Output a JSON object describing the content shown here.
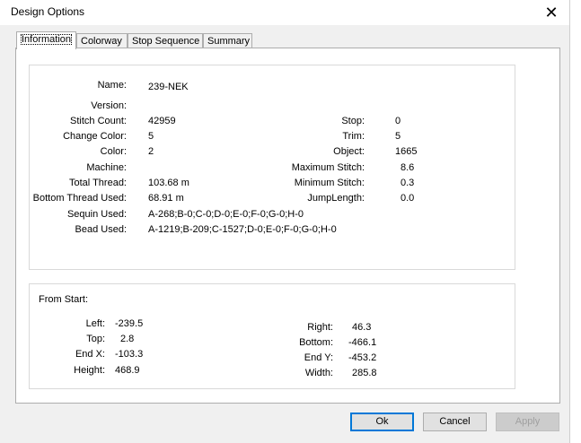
{
  "window": {
    "title": "Design Options",
    "close_glyph": "✕"
  },
  "tabs": [
    {
      "label": "Information"
    },
    {
      "label": "Colorway"
    },
    {
      "label": "Stop Sequence"
    },
    {
      "label": "Summary"
    }
  ],
  "info": {
    "name_label": "Name:",
    "name": "239-NEK",
    "version_label": "Version:",
    "version": "",
    "stitch_count_label": "Stitch Count:",
    "stitch_count": "42959",
    "change_color_label": "Change Color:",
    "change_color": "5",
    "color_label": "Color:",
    "color": "2",
    "machine_label": "Machine:",
    "machine": "",
    "total_thread_label": "Total Thread:",
    "total_thread": "103.68 m",
    "bottom_thread_label": "Bottom Thread Used:",
    "bottom_thread": "68.91 m",
    "sequin_label": "Sequin Used:",
    "sequin": "A-268;B-0;C-0;D-0;E-0;F-0;G-0;H-0",
    "bead_label": "Bead Used:",
    "bead": "A-1219;B-209;C-1527;D-0;E-0;F-0;G-0;H-0",
    "stop_label": "Stop:",
    "stop": "0",
    "trim_label": "Trim:",
    "trim": "5",
    "object_label": "Object:",
    "object": "1665",
    "max_stitch_label": "Maximum Stitch:",
    "max_stitch": "8.6",
    "min_stitch_label": "Minimum Stitch:",
    "min_stitch": "0.3",
    "jump_length_label": "JumpLength:",
    "jump_length": "0.0"
  },
  "from_start": {
    "heading": "From Start:",
    "left_label": "Left:",
    "left": "-239.5",
    "top_label": "Top:",
    "top": "2.8",
    "end_x_label": "End X:",
    "end_x": "-103.3",
    "height_label": "Height:",
    "height": "468.9",
    "right_label": "Right:",
    "right": "46.3",
    "bottom_label": "Bottom:",
    "bottom": "-466.1",
    "end_y_label": "End Y:",
    "end_y": "-453.2",
    "width_label": "Width:",
    "width": "285.8"
  },
  "buttons": {
    "ok": "Ok",
    "cancel": "Cancel",
    "apply": "Apply"
  }
}
